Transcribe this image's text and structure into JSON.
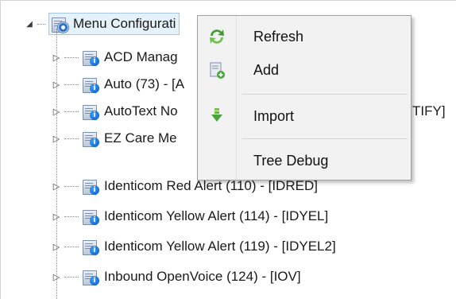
{
  "tree": {
    "root_label": "Menu Configurati",
    "items": [
      {
        "label": "ACD Manag"
      },
      {
        "label": "Auto (73) - [A"
      },
      {
        "label": "AutoText No",
        "tail": "TIFY]"
      },
      {
        "label": "EZ Care Me"
      },
      {
        "label": "Identicom Red Alert (110) - [IDRED]"
      },
      {
        "label": "Identicom Yellow Alert (114) - [IDYEL]"
      },
      {
        "label": "Identicom Yellow Alert (119) - [IDYEL2]"
      },
      {
        "label": "Inbound OpenVoice (124) - [IOV]"
      }
    ],
    "expanded_glyph": "◢",
    "collapsed_glyph": "▷"
  },
  "context_menu": {
    "items": [
      {
        "label": "Refresh",
        "icon": "refresh-icon"
      },
      {
        "label": "Add",
        "icon": "add-icon"
      },
      {
        "label": "Import",
        "icon": "import-icon"
      },
      {
        "label": "Tree Debug",
        "icon": ""
      }
    ]
  },
  "colors": {
    "selection_bg": "#e5f1fb",
    "selection_border": "#a5c7ea",
    "menu_bg": "#f2f2f2",
    "info_badge": "#0857c2",
    "refresh_green": "#3f9b2f"
  }
}
